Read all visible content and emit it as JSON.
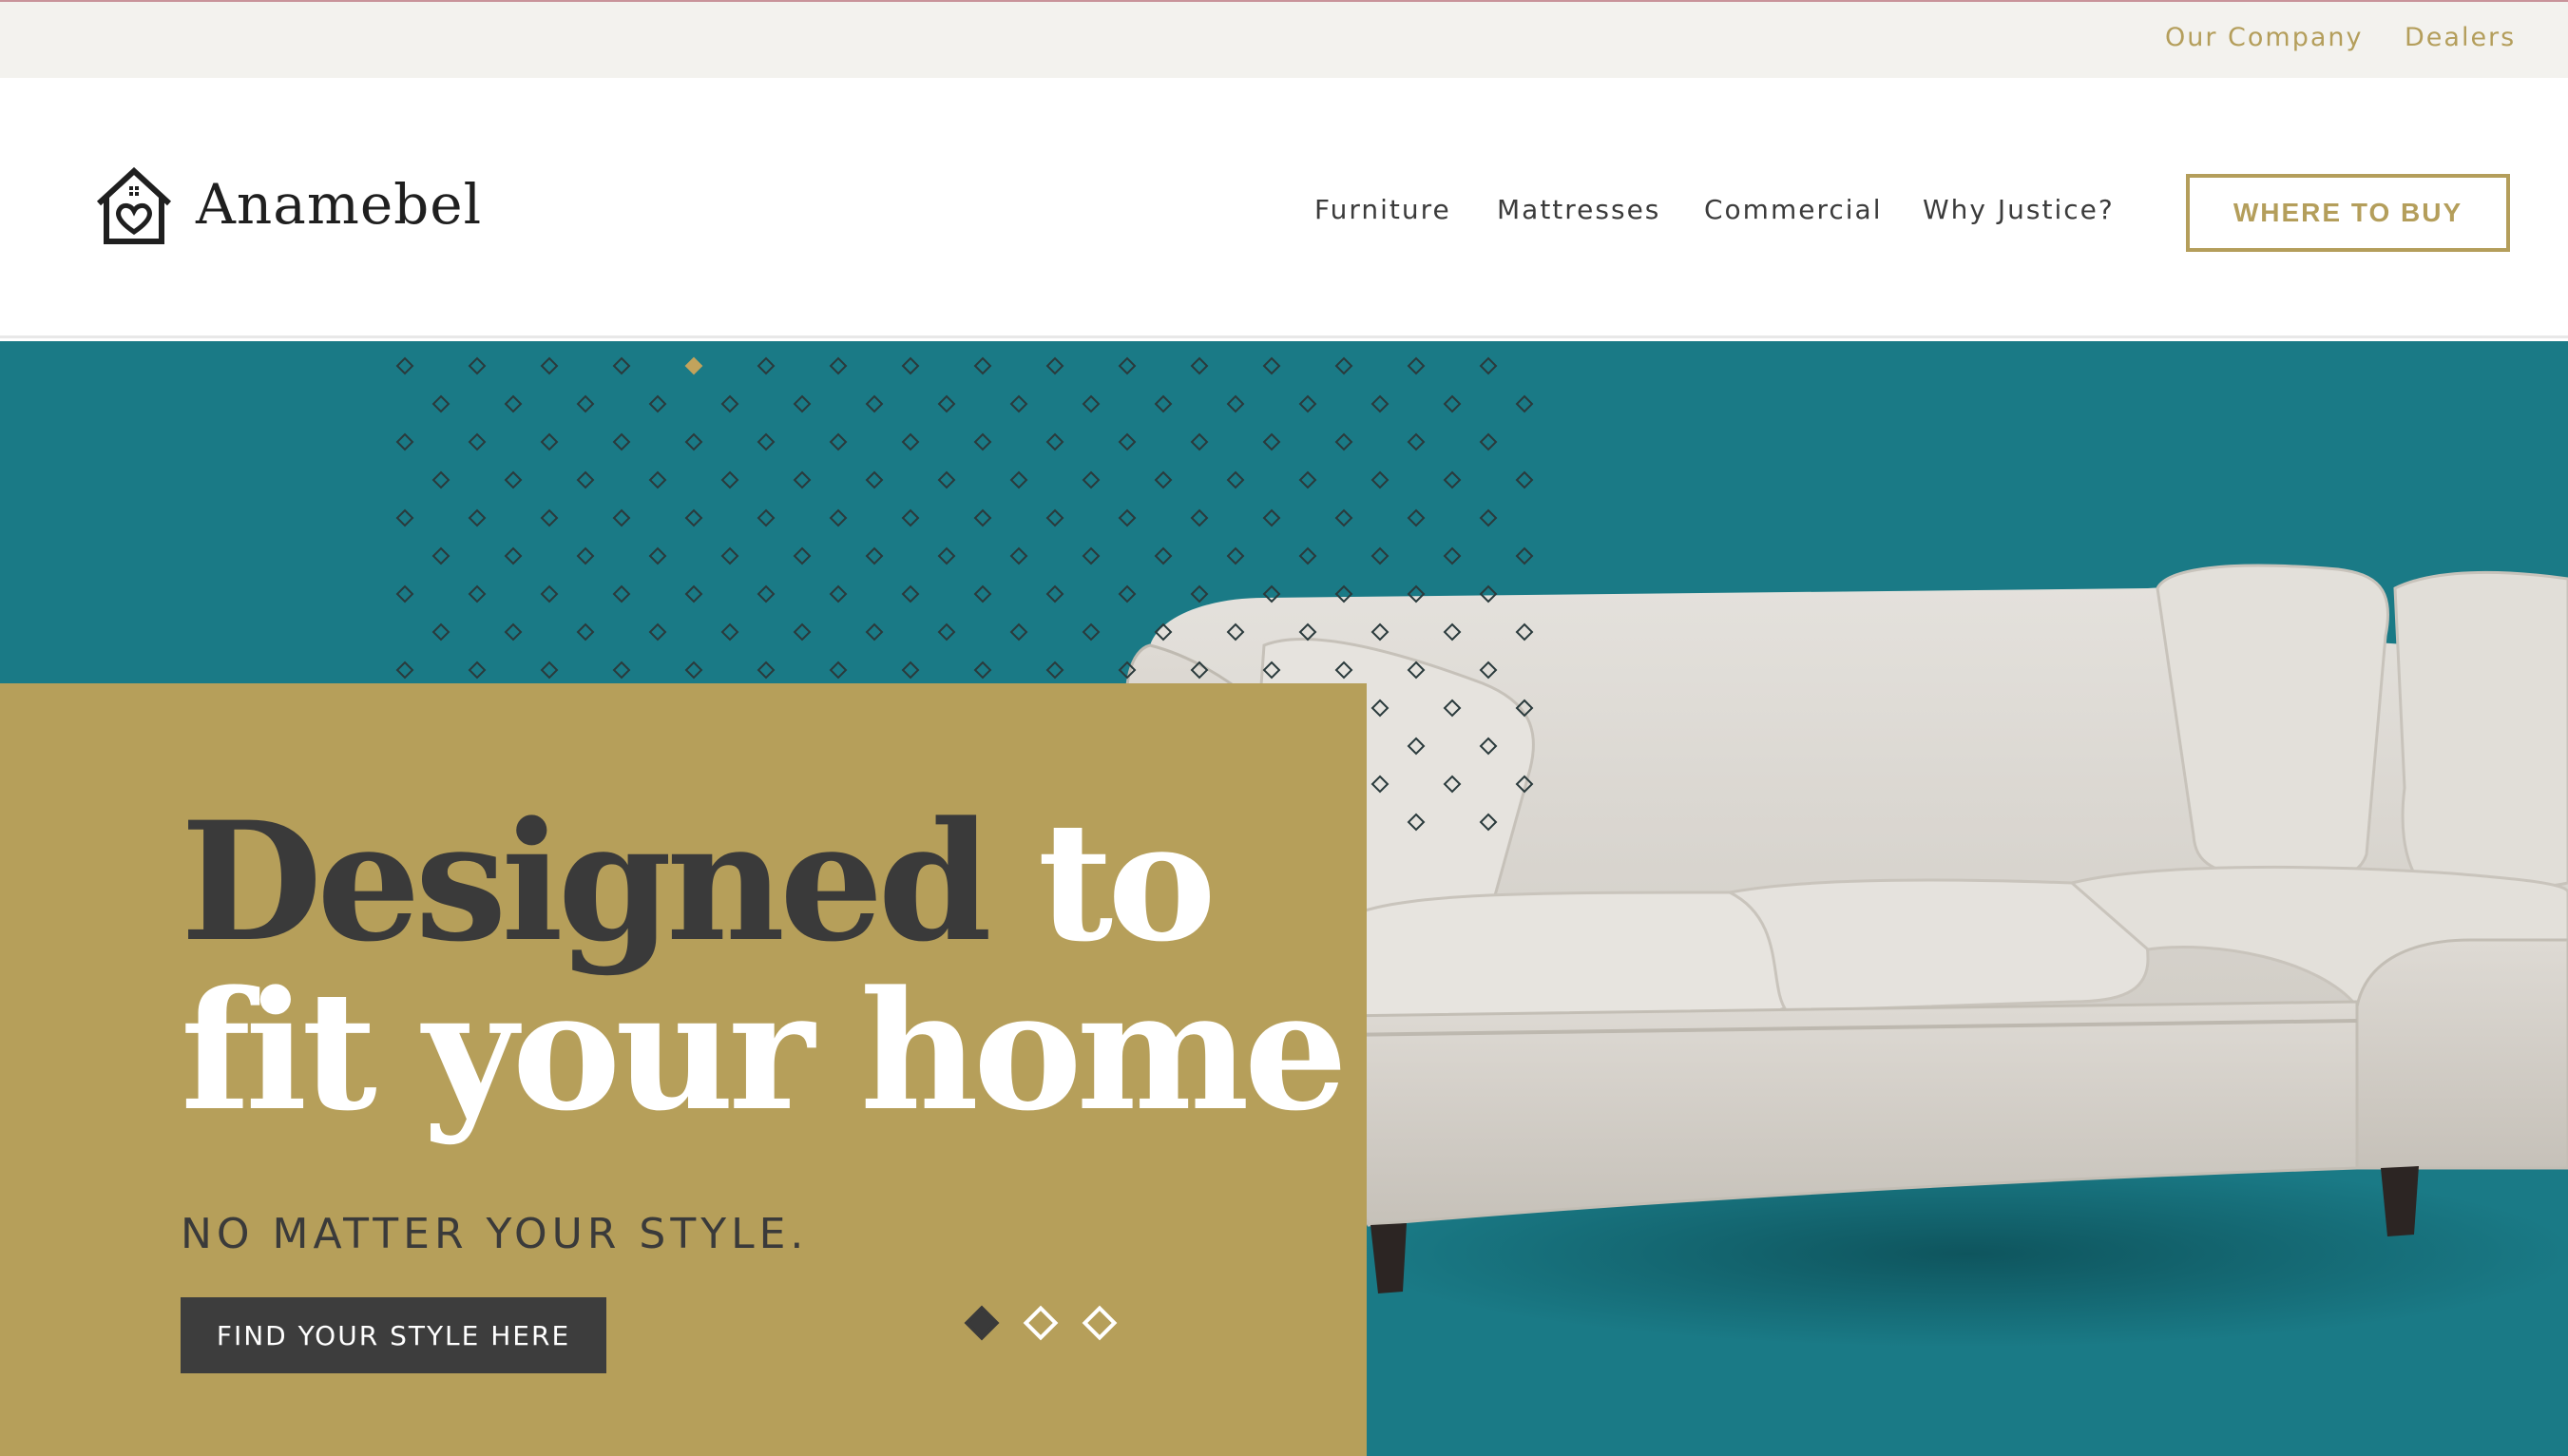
{
  "topbar": {
    "links": [
      {
        "label": "Our Company"
      },
      {
        "label": "Dealers"
      }
    ]
  },
  "header": {
    "logo_text": "Anamebel",
    "logo_icon": "house-heart-icon",
    "nav": [
      {
        "label": "Furniture"
      },
      {
        "label": "Mattresses"
      },
      {
        "label": "Commercial"
      },
      {
        "label": "Why Justice?"
      }
    ],
    "cta_label": "WHERE TO BUY"
  },
  "hero": {
    "headline_dark": "Designed",
    "headline_light_1": "to",
    "headline_light_2": "fit your home",
    "subline": "NO MATTER YOUR STYLE.",
    "cta_label": "FIND YOUR STYLE HERE",
    "slides": 3,
    "active_slide": 1,
    "image": "sectional-sofa"
  },
  "colors": {
    "teal": "#1a7a86",
    "gold": "#b69f5a",
    "accent_text": "#b49e5b",
    "dark": "#3a3a3a"
  }
}
